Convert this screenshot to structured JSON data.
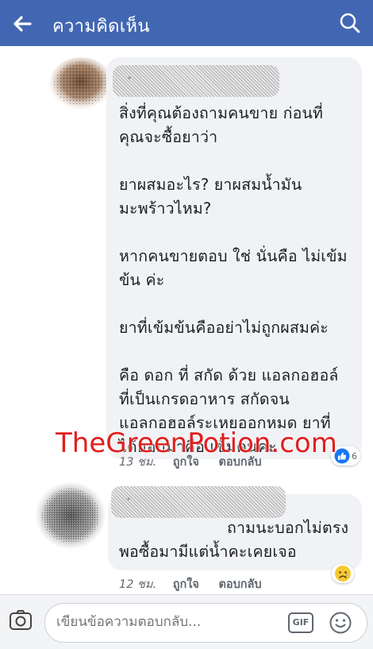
{
  "header": {
    "title": "ความคิดเห็น",
    "back_icon": "arrow-left-icon",
    "search_icon": "search-icon",
    "background": "#4267b2"
  },
  "comments": [
    {
      "text": "สิ่งที่คุณต้องถามคนขาย ก่อนที่\nคุณจะซื้อยาว่า\n\nยาผสมอะไร? ยาผสมน้ำมัน\nมะพร้าวไหม?\n\nหากคนขายตอบ ใช่ นั่นคือ ไม่เข้ม\nข้น ค่ะ\n\nยาที่เข้มข้นคืออย่าไม่ถูกผสมค่ะ\n\nคือ ดอก ที่ สกัด ด้วย แอลกอฮอล์\nที่เป็นเกรดอาหาร สกัดจน\nแอลกอฮอล์ระเหยออกหมด ยาที่\nได้ออกมาคือ เข้มคนค่ะ",
      "time": "13 ชม.",
      "like_label": "ถูกใจ",
      "reply_label": "ตอบกลับ",
      "reaction": {
        "icon": "like-thumb-icon",
        "count": "6",
        "color": "#1877f2"
      }
    },
    {
      "text": "ถามนะบอกไม่ตรง\nพอซื้อมามีแต่น้ำคะเคยเจอ",
      "time": "12 ชม.",
      "like_label": "ถูกใจ",
      "reply_label": "ตอบกลับ",
      "reaction": {
        "icon": "sad-face-icon",
        "color": "#f7c82f"
      }
    }
  ],
  "watermark": "TheGreenPotion.com",
  "composer": {
    "placeholder": "เขียนข้อความตอบกลับ...",
    "gif_label": "GIF",
    "camera_icon": "camera-icon",
    "emoji_icon": "smiley-icon"
  }
}
